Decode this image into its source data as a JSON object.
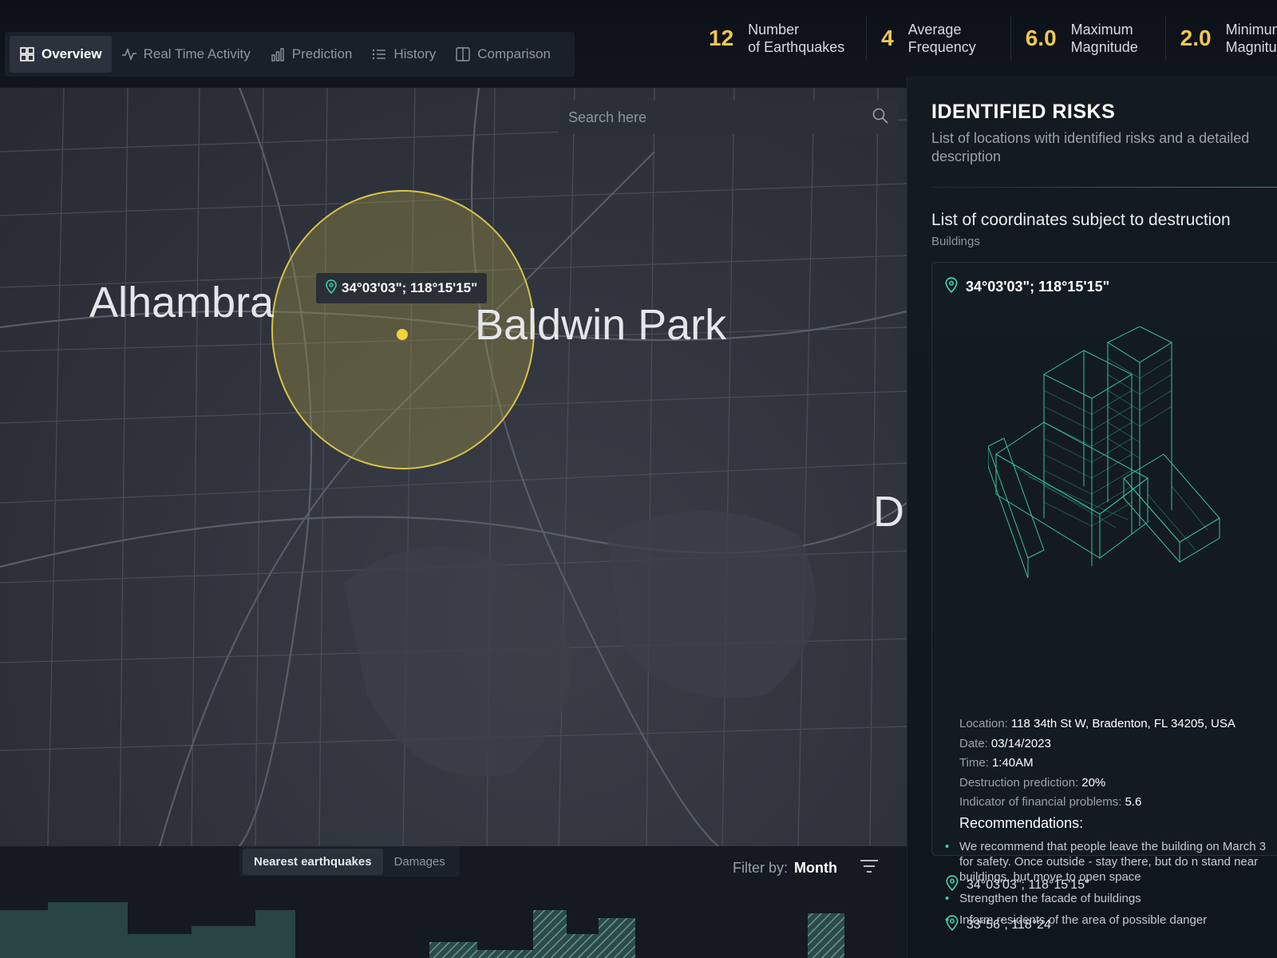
{
  "nav": {
    "items": [
      {
        "label": "Overview",
        "icon": "grid-icon",
        "active": true
      },
      {
        "label": "Real Time Activity",
        "icon": "activity-icon",
        "active": false
      },
      {
        "label": "Prediction",
        "icon": "bar-chart-icon",
        "active": false
      },
      {
        "label": "History",
        "icon": "list-icon",
        "active": false
      },
      {
        "label": "Comparison",
        "icon": "columns-icon",
        "active": false
      }
    ]
  },
  "stats": [
    {
      "value": "12",
      "label": "Number\nof Earthquakes"
    },
    {
      "value": "4",
      "label": "Average\nFrequency"
    },
    {
      "value": "6.0",
      "label": "Maximum\nMagnitude"
    },
    {
      "value": "2.0",
      "label": "Minimum\nMagnitude"
    }
  ],
  "map": {
    "search_placeholder": "Search here",
    "marker_coordinates": "34°03'03\"; 118°15'15\"",
    "cities": [
      "Alhambra",
      "Baldwin Park",
      "Di"
    ]
  },
  "bottom": {
    "tabs": [
      "Nearest earthquakes",
      "Damages"
    ],
    "filter_label": "Filter by:",
    "filter_value": "Month"
  },
  "panel": {
    "title": "IDENTIFIED RISKS",
    "description": "List of locations with identified risks and a detailed description",
    "list_title": "List of coordinates subject to destruction",
    "list_caption": "Buildings",
    "card": {
      "coordinates": "34°03'03\"; 118°15'15\"",
      "location_label": "Location:",
      "location": "118 34th St W, Bradenton, FL 34205, USA",
      "date_label": "Date:",
      "date": "03/14/2023",
      "time_label": "Time:",
      "time": "1:40AM",
      "prediction_label": "Destruction prediction:",
      "prediction": "20%",
      "financial_label": "Indicator of financial problems:",
      "financial": "5.6",
      "recommendations_title": "Recommendations:",
      "recommendations": [
        "We recommend that people leave the building on March 3 for safety. Once outside - stay there, but do n stand near buildings, but move to open space",
        "Strengthen the facade of buildings",
        "Inform residents of the area of possible danger"
      ]
    },
    "more_coordinates": [
      "34°03'03\"; 118°15'15\"",
      "33°56´; 118°24"
    ]
  },
  "colors": {
    "accent": "#f2c94c",
    "teal": "#3fd2b0",
    "panel": "#141a22"
  }
}
